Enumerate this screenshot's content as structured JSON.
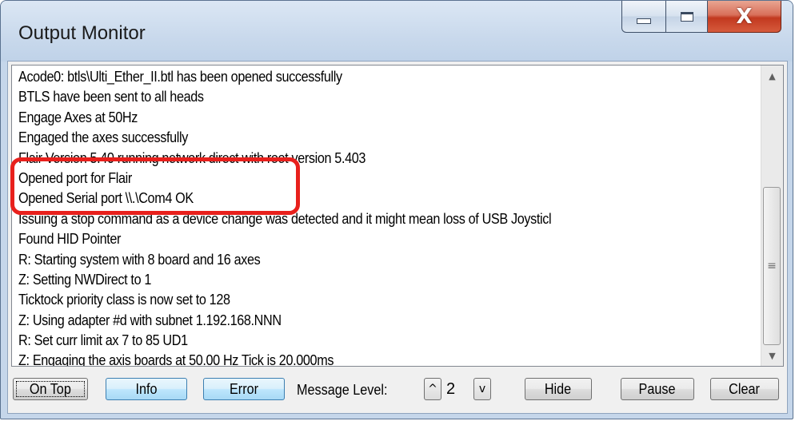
{
  "window": {
    "title": "Output Monitor",
    "controls": {
      "minimize": "minimize-icon",
      "maximize": "maximize-icon",
      "close": "close-icon"
    }
  },
  "log": {
    "lines": [
      "Acode0: btls\\Ulti_Ether_II.btl has been opened successfully",
      "BTLS have been sent to all heads",
      "Engage Axes at 50Hz",
      "Engaged the axes successfully",
      "Flair Version  5.40 running network direct with root version  5.403",
      "Opened port for Flair",
      "Opened Serial port \\\\.\\Com4 OK",
      "Issuing a stop command as a device change was detected and it might mean loss of USB Joysticl",
      "Found HID Pointer",
      "R: Starting system with 8 board and 16 axes",
      "Z: Setting NWDirect to 1",
      "Ticktock priority class is now set to 128",
      "Z: Using adapter #d with subnet 1.192.168.NNN",
      "R: Set curr limit ax 7 to 85 UD1",
      "Z: Engaging the axis boards at 50.00 Hz Tick is 20.000ms"
    ],
    "highlight_color": "#e8201c"
  },
  "scrollbar": {
    "up": "▲",
    "down": "▼",
    "grip": "≡"
  },
  "toolbar": {
    "on_top": "On Top",
    "info": "Info",
    "error": "Error",
    "message_level_label": "Message Level:",
    "level_up": "^",
    "level_value": "2",
    "level_down": "v",
    "hide": "Hide",
    "pause": "Pause",
    "clear": "Clear"
  },
  "colors": {
    "accent_blue": "#bee6fd",
    "frame": "#c5d6ea",
    "close": "#c2391f"
  }
}
